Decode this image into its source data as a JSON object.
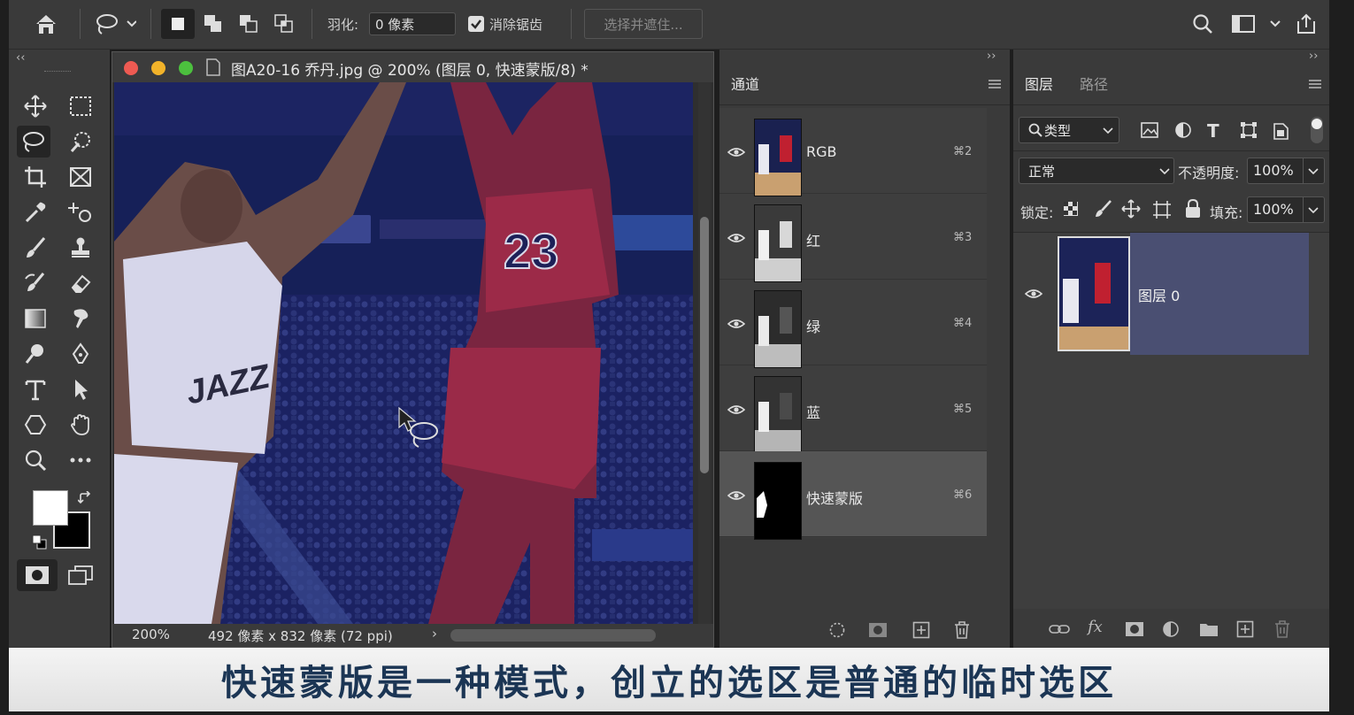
{
  "options_bar": {
    "feather_label": "羽化:",
    "feather_value": "0 像素",
    "antialias_label": "消除锯齿",
    "select_mask_label": "选择并遮住..."
  },
  "document": {
    "title": "图A20-16 乔丹.jpg @ 200% (图层 0, 快速蒙版/8) *",
    "zoom": "200%",
    "dimensions": "492 像素 x 832 像素 (72 ppi)"
  },
  "channels_panel": {
    "tab": "通道",
    "channels": [
      {
        "name": "RGB",
        "shortcut": "⌘2"
      },
      {
        "name": "红",
        "shortcut": "⌘3"
      },
      {
        "name": "绿",
        "shortcut": "⌘4"
      },
      {
        "name": "蓝",
        "shortcut": "⌘5"
      },
      {
        "name": "快速蒙版",
        "shortcut": "⌘6"
      }
    ]
  },
  "layers_panel": {
    "tab_layers": "图层",
    "tab_paths": "路径",
    "filter_label": "类型",
    "blend_mode": "正常",
    "opacity_label": "不透明度:",
    "opacity_value": "100%",
    "lock_label": "锁定:",
    "fill_label": "填充:",
    "fill_value": "100%",
    "layer_name": "图层 0"
  },
  "caption": "快速蒙版是一种模式，创立的选区是普通的临时选区",
  "colors": {
    "panel_bg": "#3a3a3a",
    "selected_layer": "#4a4f72",
    "quick_mask_overlay": "#1a2260",
    "caption_text": "#1b3554"
  }
}
